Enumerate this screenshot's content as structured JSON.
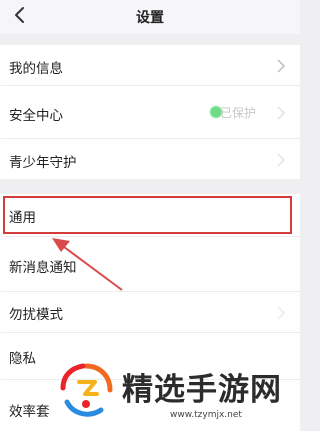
{
  "header": {
    "title": "设置"
  },
  "rows": {
    "my_info": "我的信息",
    "security": "安全中心",
    "security_status": "已保护",
    "youth": "青少年守护",
    "general": "通用",
    "new_msg": "新消息通知",
    "dnd": "勿扰模式",
    "privacy": "隐私",
    "efficiency": "效率套"
  },
  "watermark": {
    "brand": "精选手游网",
    "url": "www.tzymjx.net"
  },
  "colors": {
    "highlight": "#d63b3b",
    "background": "#efeff2",
    "row": "#ffffff"
  }
}
